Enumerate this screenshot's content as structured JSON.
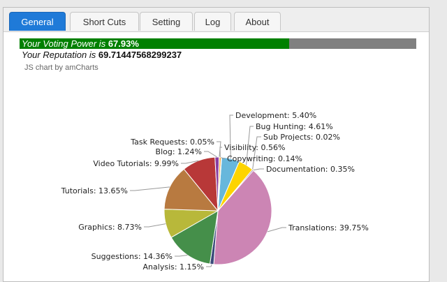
{
  "tabs": [
    {
      "label": "General",
      "active": true
    },
    {
      "label": "Short Cuts",
      "active": false
    },
    {
      "label": "Setting",
      "active": false
    },
    {
      "label": "Log",
      "active": false
    },
    {
      "label": "About",
      "active": false
    }
  ],
  "voting_power": {
    "prefix": "Your Voting Power is ",
    "value": "67.93%",
    "fraction": 0.6793
  },
  "reputation": {
    "prefix": "Your Reputation is ",
    "value": "69.71447568299237"
  },
  "credit": "JS chart by amCharts",
  "chart_data": {
    "type": "pie",
    "slices": [
      {
        "name": "Development",
        "label": "Development: 5.40%",
        "value": 5.4,
        "color": "#67b7dc"
      },
      {
        "name": "Bug Hunting",
        "label": "Bug Hunting: 4.61%",
        "value": 4.61,
        "color": "#fdd400"
      },
      {
        "name": "Sub Projects",
        "label": "Sub Projects: 0.02%",
        "value": 0.02,
        "color": "#84b761"
      },
      {
        "name": "Documentation",
        "label": "Documentation: 0.35%",
        "value": 0.35,
        "color": "#7c4c94"
      },
      {
        "name": "Translations",
        "label": "Translations: 39.75%",
        "value": 39.75,
        "color": "#cc85b4"
      },
      {
        "name": "Analysis",
        "label": "Analysis: 1.15%",
        "value": 1.15,
        "color": "#3a4a7a"
      },
      {
        "name": "Suggestions",
        "label": "Suggestions: 14.36%",
        "value": 14.36,
        "color": "#458f4a"
      },
      {
        "name": "Graphics",
        "label": "Graphics: 8.73%",
        "value": 8.73,
        "color": "#b8b83a"
      },
      {
        "name": "Tutorials",
        "label": "Tutorials: 13.65%",
        "value": 13.65,
        "color": "#b87a40"
      },
      {
        "name": "Video Tutorials",
        "label": "Video Tutorials: 9.99%",
        "value": 9.99,
        "color": "#b83838"
      },
      {
        "name": "Blog",
        "label": "Blog: 1.24%",
        "value": 1.24,
        "color": "#8a3fa0"
      },
      {
        "name": "Task Requests",
        "label": "Task Requests: 0.05%",
        "value": 0.05,
        "color": "#d8d8d8"
      },
      {
        "name": "Visibility",
        "label": "Visibility: 0.56%",
        "value": 0.56,
        "color": "#f0a030"
      },
      {
        "name": "Copywriting",
        "label": "Copywriting: 0.14%",
        "value": 0.14,
        "color": "#9ad2e8"
      }
    ]
  }
}
